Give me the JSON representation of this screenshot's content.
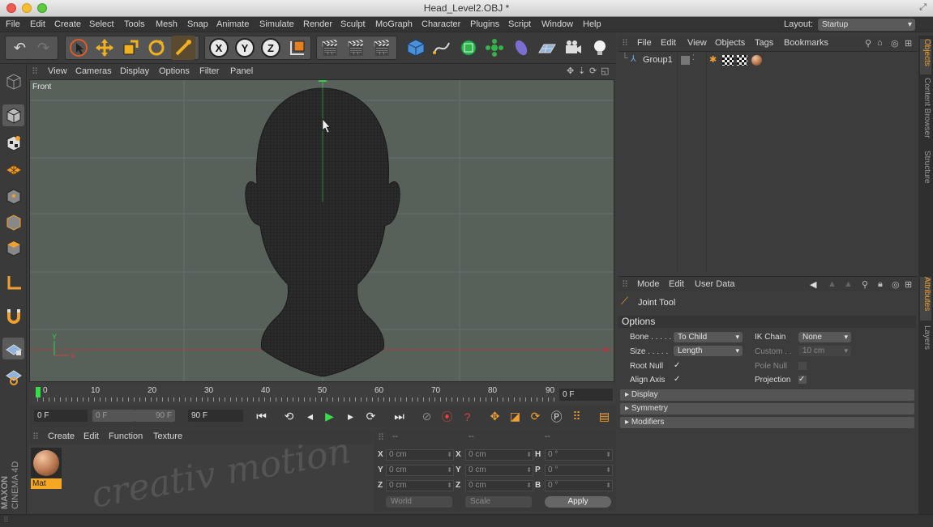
{
  "window": {
    "title": "Head_Level2.OBJ *"
  },
  "menubar": {
    "items": [
      "File",
      "Edit",
      "Create",
      "Select",
      "Tools",
      "Mesh",
      "Snap",
      "Animate",
      "Simulate",
      "Render",
      "Sculpt",
      "MoGraph",
      "Character",
      "Plugins",
      "Script",
      "Window",
      "Help"
    ],
    "layout_label": "Layout:",
    "layout_value": "Startup"
  },
  "viewport": {
    "menu": [
      "View",
      "Cameras",
      "Display",
      "Options",
      "Filter",
      "Panel"
    ],
    "label": "Front"
  },
  "timeline": {
    "ticks": [
      "0",
      "10",
      "20",
      "30",
      "40",
      "50",
      "60",
      "70",
      "80",
      "90"
    ],
    "current_frame": "0 F"
  },
  "transport": {
    "start": "0 F",
    "range_start": "0 F",
    "range_end": "90 F",
    "end": "90 F"
  },
  "material_manager": {
    "menu": [
      "Create",
      "Edit",
      "Function",
      "Texture"
    ],
    "material_name": "Mat"
  },
  "coordinates": {
    "headers": [
      "--",
      "--",
      "--"
    ],
    "rows": [
      {
        "l1": "X",
        "v1": "0 cm",
        "l2": "X",
        "v2": "0 cm",
        "l3": "H",
        "v3": "0 °"
      },
      {
        "l1": "Y",
        "v1": "0 cm",
        "l2": "Y",
        "v2": "0 cm",
        "l3": "P",
        "v3": "0 °"
      },
      {
        "l1": "Z",
        "v1": "0 cm",
        "l2": "Z",
        "v2": "0 cm",
        "l3": "B",
        "v3": "0 °"
      }
    ],
    "space": "World",
    "mode": "Scale",
    "apply": "Apply"
  },
  "object_manager": {
    "menu": [
      "File",
      "Edit",
      "View",
      "Objects",
      "Tags",
      "Bookmarks"
    ],
    "objects": [
      {
        "name": "Group1"
      }
    ]
  },
  "attributes": {
    "menu": [
      "Mode",
      "Edit",
      "User Data"
    ],
    "tool_name": "Joint Tool",
    "options_header": "Options",
    "bone_label": "Bone . . . . .",
    "bone_value": "To Child",
    "size_label": "Size . . . . .",
    "size_value": "Length",
    "root_null_label": "Root Null",
    "align_axis_label": "Align Axis",
    "ik_chain_label": "IK Chain",
    "ik_chain_value": "None",
    "custom_label": "Custom . .",
    "custom_value": "10 cm",
    "pole_null_label": "Pole Null",
    "projection_label": "Projection",
    "check_mark": "✓",
    "sections": [
      "Display",
      "Symmetry",
      "Modifiers"
    ]
  },
  "side_tabs": [
    "Objects",
    "Content Browser",
    "Structure",
    "Attributes",
    "Layers"
  ],
  "branding": {
    "watermark": "creativ motion",
    "logo_top": "MAXON",
    "logo_bottom": "CINEMA 4D"
  }
}
